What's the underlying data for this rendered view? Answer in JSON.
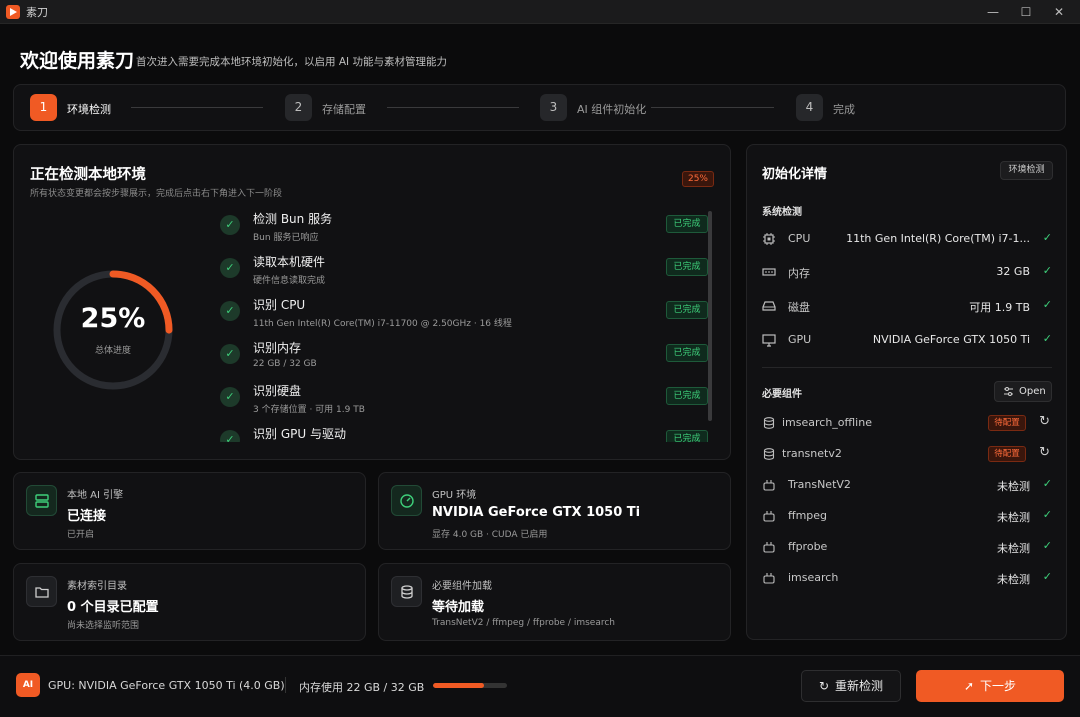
{
  "window": {
    "title": "素刀",
    "min": "—",
    "max": "☐",
    "close": "✕"
  },
  "header": {
    "title": "欢迎使用素刀",
    "subtitle": "首次进入需要完成本地环境初始化，以启用 AI 功能与素材管理能力"
  },
  "steps": [
    {
      "num": "1",
      "label": "环境检测"
    },
    {
      "num": "2",
      "label": "存储配置"
    },
    {
      "num": "3",
      "label": "AI 组件初始化"
    },
    {
      "num": "4",
      "label": "完成"
    }
  ],
  "detect": {
    "title": "正在检测本地环境",
    "subtitle": "所有状态变更都会按步骤展示，完成后点击右下角进入下一阶段",
    "progress_badge": "25%",
    "progress": 0.25,
    "progress_label": "25%",
    "progress_caption": "总体进度",
    "items": [
      {
        "title": "检测 Bun 服务",
        "sub": "Bun 服务已响应",
        "status": "已完成"
      },
      {
        "title": "读取本机硬件",
        "sub": "硬件信息读取完成",
        "status": "已完成"
      },
      {
        "title": "识别 CPU",
        "sub": "11th Gen Intel(R) Core(TM) i7-11700 @ 2.50GHz · 16 线程",
        "status": "已完成"
      },
      {
        "title": "识别内存",
        "sub": "22 GB / 32 GB",
        "status": "已完成"
      },
      {
        "title": "识别硬盘",
        "sub": "3 个存储位置 · 可用 1.9 TB",
        "status": "已完成"
      },
      {
        "title": "识别 GPU 与驱动",
        "sub": "",
        "status": "已完成"
      }
    ]
  },
  "cards": [
    {
      "label": "本地 AI 引擎",
      "value": "已连接",
      "sub": "已开启",
      "icon": "server-icon"
    },
    {
      "label": "GPU 环境",
      "value": "NVIDIA GeForce GTX 1050 Ti",
      "sub": "显存 4.0 GB · CUDA 已启用",
      "icon": "gauge-icon"
    },
    {
      "label": "素材索引目录",
      "value": "0 个目录已配置",
      "sub": "尚未选择监听范围",
      "icon": "folder-icon"
    },
    {
      "label": "必要组件加载",
      "value": "等待加载",
      "sub": "TransNetV2 / ffmpeg / ffprobe / imsearch",
      "icon": "database-icon"
    }
  ],
  "side": {
    "title": "初始化详情",
    "tag": "环境检测",
    "system_title": "系统检测",
    "system": [
      {
        "name": "CPU",
        "value": "11th Gen Intel(R) Core(TM) i7-1...",
        "icon": "cpu-icon"
      },
      {
        "name": "内存",
        "value": "32 GB",
        "icon": "memory-icon"
      },
      {
        "name": "磁盘",
        "value": "可用 1.9 TB",
        "icon": "disk-icon"
      },
      {
        "name": "GPU",
        "value": "NVIDIA GeForce GTX 1050 Ti",
        "icon": "monitor-icon"
      }
    ],
    "components_title": "必要组件",
    "open_label": "Open",
    "components": [
      {
        "name": "imsearch_offline",
        "status": "待配置",
        "type": "pending"
      },
      {
        "name": "transnetv2",
        "status": "待配置",
        "type": "pending"
      },
      {
        "name": "TransNetV2",
        "status": "未检测",
        "type": "ok"
      },
      {
        "name": "ffmpeg",
        "status": "未检测",
        "type": "ok"
      },
      {
        "name": "ffprobe",
        "status": "未检测",
        "type": "ok"
      },
      {
        "name": "imsearch",
        "status": "未检测",
        "type": "ok"
      }
    ]
  },
  "footer": {
    "ai_badge": "AI",
    "gpu": "GPU: NVIDIA GeForce GTX 1050 Ti (4.0 GB)",
    "memory": "内存使用 22 GB / 32 GB",
    "memory_usage": 0.69,
    "recheck_label": "重新检测",
    "next_label": "下一步"
  },
  "colors": {
    "accent": "#f05a24",
    "success": "#3ecf7a"
  }
}
